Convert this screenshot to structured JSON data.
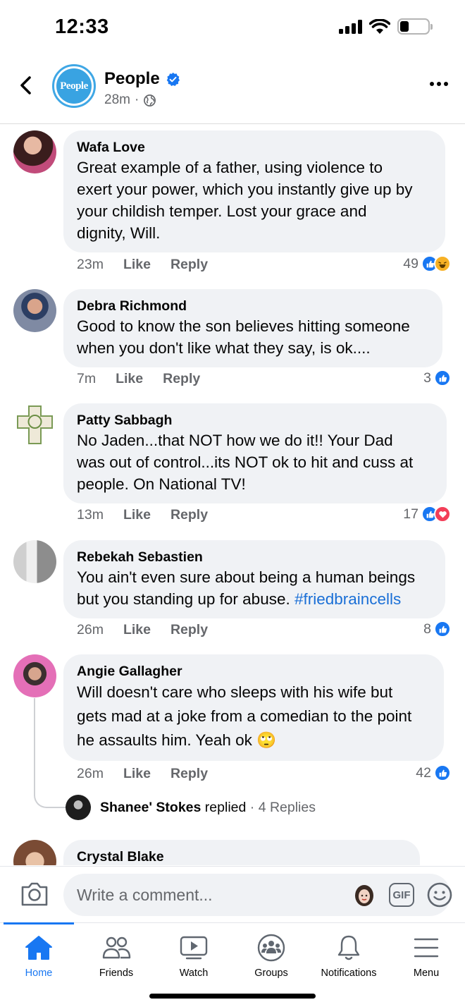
{
  "status_bar": {
    "time": "12:33"
  },
  "header": {
    "page_name": "People",
    "avatar_text": "People",
    "time_ago": "28m",
    "separator": "·"
  },
  "comments": [
    {
      "name": "Wafa Love",
      "text": "Great example of a father, using violence to\nexert your power, which you instantly give up by\nyour childish temper. Lost your grace and\ndignity, Will.",
      "time": "23m",
      "like_label": "Like",
      "reply_label": "Reply",
      "reaction_count": "49",
      "reactions": [
        "like",
        "haha"
      ]
    },
    {
      "name": "Debra Richmond",
      "text": "Good to know the son believes hitting someone\nwhen you don't like what they say, is ok....",
      "time": "7m",
      "like_label": "Like",
      "reply_label": "Reply",
      "reaction_count": "3",
      "reactions": [
        "like"
      ]
    },
    {
      "name": "Patty Sabbagh",
      "text": "No Jaden...that NOT how we do it!! Your Dad\nwas out of control...its NOT ok to hit and cuss at\npeople. On National TV!",
      "time": "13m",
      "like_label": "Like",
      "reply_label": "Reply",
      "reaction_count": "17",
      "reactions": [
        "like",
        "love"
      ]
    },
    {
      "name": "Rebekah Sebastien",
      "text_main": "You ain't even sure about being a human beings\nbut you standing up for abuse. ",
      "hashtag": "#friedbraincells",
      "time": "26m",
      "like_label": "Like",
      "reply_label": "Reply",
      "reaction_count": "8",
      "reactions": [
        "like"
      ]
    },
    {
      "name": "Angie Gallagher",
      "text": "Will doesn't care who sleeps with his wife but\ngets mad at a joke from a comedian to the point\nhe assaults him. Yeah ok",
      "emoji": "🙄",
      "time": "26m",
      "like_label": "Like",
      "reply_label": "Reply",
      "reaction_count": "42",
      "reactions": [
        "like"
      ],
      "replied": {
        "name": "Shanee' Stokes",
        "action": "replied",
        "dot": "·",
        "count": "4 Replies"
      }
    },
    {
      "name": "Crystal Blake"
    }
  ],
  "composer": {
    "placeholder": "Write a comment...",
    "gif_label": "GIF"
  },
  "tabs": [
    {
      "label": "Home",
      "icon": "home-icon",
      "active": true
    },
    {
      "label": "Friends",
      "icon": "friends-icon"
    },
    {
      "label": "Watch",
      "icon": "watch-icon"
    },
    {
      "label": "Groups",
      "icon": "groups-icon"
    },
    {
      "label": "Notifications",
      "icon": "bell-icon"
    },
    {
      "label": "Menu",
      "icon": "menu-icon"
    }
  ],
  "colors": {
    "accent": "#1877f2",
    "bubble": "#f0f2f5",
    "muted": "#65676b",
    "hashtag": "#1a6fd6"
  }
}
